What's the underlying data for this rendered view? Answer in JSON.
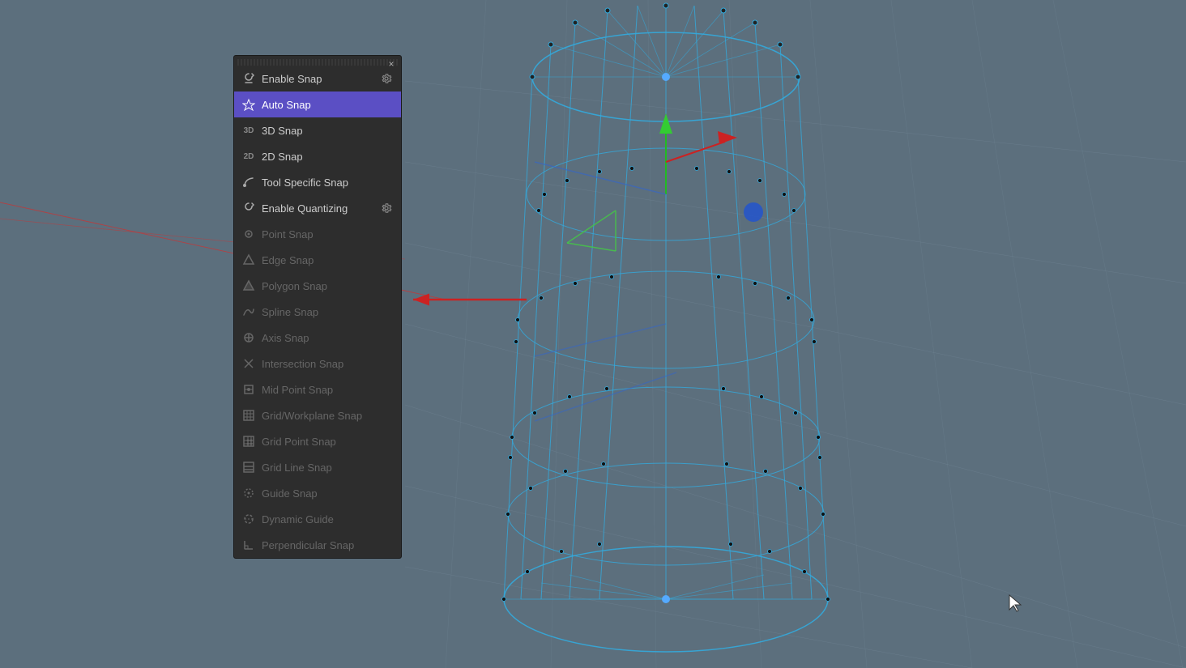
{
  "viewport": {
    "background_color": "#5c6f7d"
  },
  "panel": {
    "close_label": "×",
    "items": [
      {
        "id": "enable-snap",
        "label": "Enable Snap",
        "icon": "⟳",
        "icon_type": "refresh",
        "has_gear": true,
        "active": false,
        "disabled": false
      },
      {
        "id": "auto-snap",
        "label": "Auto Snap",
        "icon": "△",
        "icon_type": "triangle",
        "has_gear": false,
        "active": true,
        "disabled": false
      },
      {
        "id": "3d-snap",
        "label": "3D Snap",
        "icon": "3D",
        "icon_type": "text",
        "has_gear": false,
        "active": false,
        "disabled": false
      },
      {
        "id": "2d-snap",
        "label": "2D Snap",
        "icon": "2D",
        "icon_type": "text",
        "has_gear": false,
        "active": false,
        "disabled": false
      },
      {
        "id": "tool-specific-snap",
        "label": "Tool Specific Snap",
        "icon": "⟲",
        "icon_type": "curve",
        "has_gear": false,
        "active": false,
        "disabled": false
      },
      {
        "id": "enable-quantizing",
        "label": "Enable Quantizing",
        "icon": "⟳",
        "icon_type": "refresh",
        "has_gear": true,
        "active": false,
        "disabled": false
      },
      {
        "id": "point-snap",
        "label": "Point Snap",
        "icon": "⊙",
        "icon_type": "point",
        "has_gear": false,
        "active": false,
        "disabled": true
      },
      {
        "id": "edge-snap",
        "label": "Edge Snap",
        "icon": "△",
        "icon_type": "triangle-edge",
        "has_gear": false,
        "active": false,
        "disabled": true
      },
      {
        "id": "polygon-snap",
        "label": "Polygon Snap",
        "icon": "△",
        "icon_type": "polygon",
        "has_gear": false,
        "active": false,
        "disabled": true
      },
      {
        "id": "spline-snap",
        "label": "Spline Snap",
        "icon": "∿",
        "icon_type": "spline",
        "has_gear": false,
        "active": false,
        "disabled": true
      },
      {
        "id": "axis-snap",
        "label": "Axis Snap",
        "icon": "⊕",
        "icon_type": "axis",
        "has_gear": false,
        "active": false,
        "disabled": true
      },
      {
        "id": "intersection-snap",
        "label": "Intersection Snap",
        "icon": "✕",
        "icon_type": "intersection",
        "has_gear": false,
        "active": false,
        "disabled": true
      },
      {
        "id": "mid-point-snap",
        "label": "Mid Point Snap",
        "icon": "⊞",
        "icon_type": "midpoint",
        "has_gear": false,
        "active": false,
        "disabled": true
      },
      {
        "id": "grid-workplane-snap",
        "label": "Grid/Workplane Snap",
        "icon": "⚙",
        "icon_type": "grid",
        "has_gear": false,
        "active": false,
        "disabled": true
      },
      {
        "id": "grid-point-snap",
        "label": "Grid Point Snap",
        "icon": "⊞",
        "icon_type": "grid-point",
        "has_gear": false,
        "active": false,
        "disabled": true
      },
      {
        "id": "grid-line-snap",
        "label": "Grid Line Snap",
        "icon": "⊟",
        "icon_type": "grid-line",
        "has_gear": false,
        "active": false,
        "disabled": true
      },
      {
        "id": "guide-snap",
        "label": "Guide Snap",
        "icon": "⊙",
        "icon_type": "guide",
        "has_gear": false,
        "active": false,
        "disabled": true
      },
      {
        "id": "dynamic-guide",
        "label": "Dynamic Guide",
        "icon": "⊙",
        "icon_type": "dynamic",
        "has_gear": false,
        "active": false,
        "disabled": true
      },
      {
        "id": "perpendicular-snap",
        "label": "Perpendicular Snap",
        "icon": "⌐",
        "icon_type": "perp",
        "has_gear": false,
        "active": false,
        "disabled": true
      }
    ]
  },
  "icons": {
    "enable_snap": "↺",
    "auto_snap": "▲",
    "snap_3d": "3D",
    "snap_2d": "2D",
    "tool_specific": "⟲",
    "enable_quantizing": "↺",
    "gear": "⚙",
    "close": "×"
  }
}
